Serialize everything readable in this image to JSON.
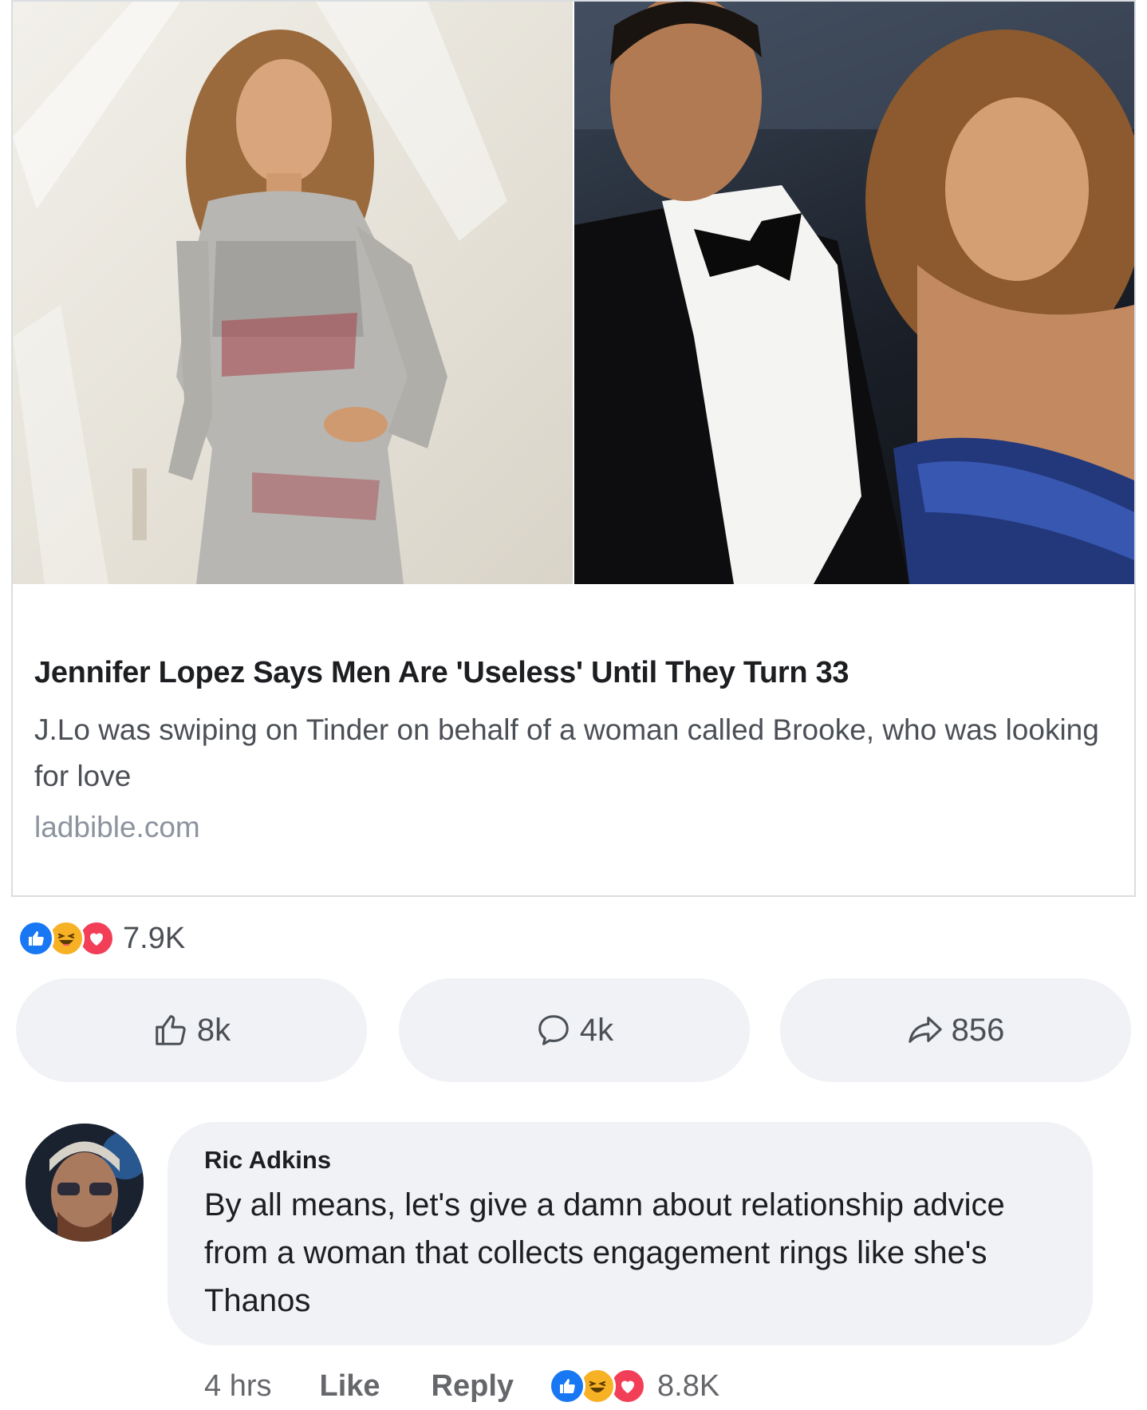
{
  "post": {
    "headline": "Jennifer Lopez Says Men Are 'Useless' Until They Turn 33",
    "description": "J.Lo was swiping on Tinder on behalf of a woman called Brooke, who was looking for love",
    "domain": "ladbible.com"
  },
  "reactions": {
    "icons": [
      "like-icon",
      "haha-icon",
      "love-icon"
    ],
    "count": "7.9K"
  },
  "actions": {
    "like_count": "8k",
    "comment_count": "4k",
    "share_count": "856"
  },
  "comment": {
    "author": "Ric Adkins",
    "text": "By all means,  let's give a damn about relationship advice from a woman that collects engagement rings like she's Thanos",
    "time": "4 hrs",
    "like_label": "Like",
    "reply_label": "Reply",
    "reaction_icons": [
      "like-icon",
      "haha-icon",
      "love-icon"
    ],
    "reaction_count": "8.8K"
  },
  "colors": {
    "like_blue": "#1877f2",
    "haha_yellow": "#f7b125",
    "love_red": "#f33e58",
    "bubble_gray": "#f0f2f5"
  }
}
